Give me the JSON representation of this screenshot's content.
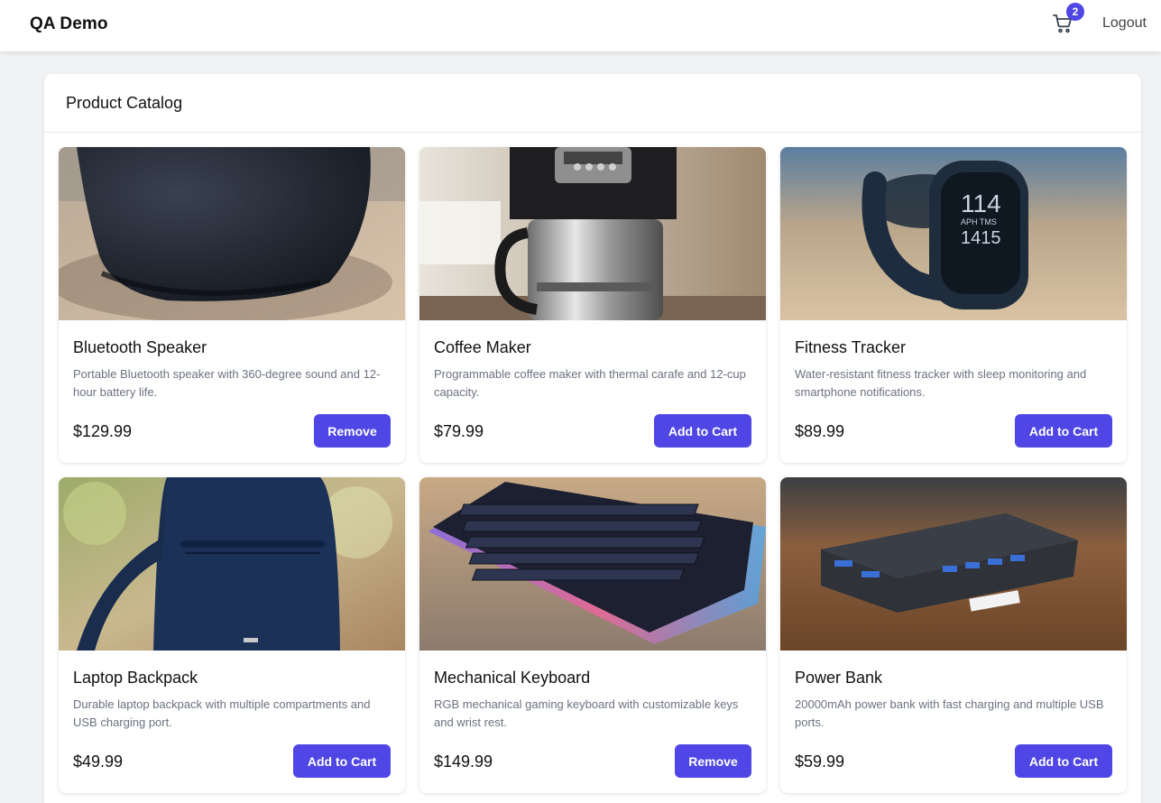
{
  "app": {
    "brand": "QA Demo",
    "cart_count": "2",
    "logout_label": "Logout"
  },
  "catalog": {
    "title": "Product Catalog",
    "products": [
      {
        "name": "Bluetooth Speaker",
        "description": "Portable Bluetooth speaker with 360-degree sound and 12-hour battery life.",
        "price": "$129.99",
        "action": "Remove",
        "image": "speaker-photo"
      },
      {
        "name": "Coffee Maker",
        "description": "Programmable coffee maker with thermal carafe and 12-cup capacity.",
        "price": "$79.99",
        "action": "Add to Cart",
        "image": "coffee-maker-photo"
      },
      {
        "name": "Fitness Tracker",
        "description": "Water-resistant fitness tracker with sleep monitoring and smartphone notifications.",
        "price": "$89.99",
        "action": "Add to Cart",
        "image": "fitness-tracker-photo"
      },
      {
        "name": "Laptop Backpack",
        "description": "Durable laptop backpack with multiple compartments and USB charging port.",
        "price": "$49.99",
        "action": "Add to Cart",
        "image": "backpack-photo"
      },
      {
        "name": "Mechanical Keyboard",
        "description": "RGB mechanical gaming keyboard with customizable keys and wrist rest.",
        "price": "$149.99",
        "action": "Remove",
        "image": "keyboard-photo"
      },
      {
        "name": "Power Bank",
        "description": "20000mAh power bank with fast charging and multiple USB ports.",
        "price": "$59.99",
        "action": "Add to Cart",
        "image": "power-bank-photo"
      }
    ]
  },
  "tracker_screen": {
    "line1": "114",
    "line2": "APH TMS",
    "line3": "1415"
  },
  "colors": {
    "accent": "#4f46e5",
    "page_bg": "#f1f2f4",
    "muted_text": "#6b7280"
  }
}
